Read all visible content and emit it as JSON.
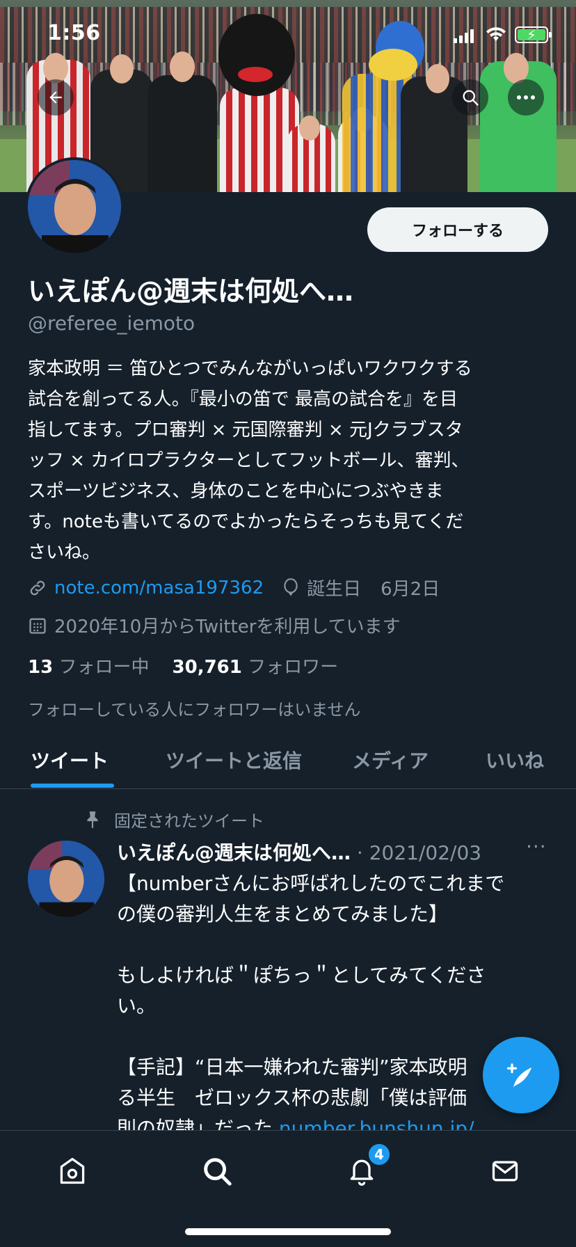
{
  "status_bar": {
    "time": "1:56"
  },
  "profile": {
    "display_name": "いえぽん@週末は何処へ…",
    "handle": "@referee_iemoto",
    "follow_label": "フォローする",
    "bio": [
      "家本政明 ＝ 笛ひとつでみんながいっぱいワクワクする",
      "試合を創ってる人。『最小の笛で 最高の試合を』を目",
      "指してます。プロ審判 × 元国際審判 × 元Jクラブスタ",
      "ッフ × カイロプラクターとしてフットボール、審判、",
      "スポーツビジネス、身体のことを中心につぶやきま",
      "す。noteも書いてるのでよかったらそっちも見てくだ",
      "さいね。"
    ],
    "link": "note.com/masa197362",
    "birthday_label": "誕生日",
    "birthday": "6月2日",
    "joined": "2020年10月からTwitterを利用しています",
    "following_count": "13",
    "following_label": "フォロー中",
    "followers_count": "30,761",
    "followers_label": "フォロワー",
    "no_followers_you_know": "フォローしている人にフォロワーはいません"
  },
  "tabs": [
    {
      "label": "ツイート",
      "active": true
    },
    {
      "label": "ツイートと返信",
      "active": false
    },
    {
      "label": "メディア",
      "active": false
    },
    {
      "label": "いいね",
      "active": false
    }
  ],
  "pinned_tweet": {
    "pinned_label": "固定されたツイート",
    "author": "いえぽん@週末は何処へ…",
    "separator": "·",
    "date": "2021/02/03",
    "more": "···",
    "lines": [
      "【numberさんにお呼ばれしたのでこれまで",
      "の僕の審判人生をまとめてみました】",
      "",
      "もしよければ＂ぽちっ＂としてみてくださ",
      "い。",
      "",
      "【手記】“日本一嫌われた審判”家本政明",
      "る半生　ゼロックス杯の悲劇「僕は評価",
      "則の奴隷」だった"
    ],
    "link": "number.bunshun.jp/"
  },
  "bottom_nav": {
    "items": [
      "home-icon",
      "search-icon",
      "notifications-icon",
      "messages-icon"
    ],
    "notification_badge": "4"
  },
  "colors": {
    "background": "#15202b",
    "accent": "#1d9bf0",
    "secondary_text": "#8b98a5"
  }
}
